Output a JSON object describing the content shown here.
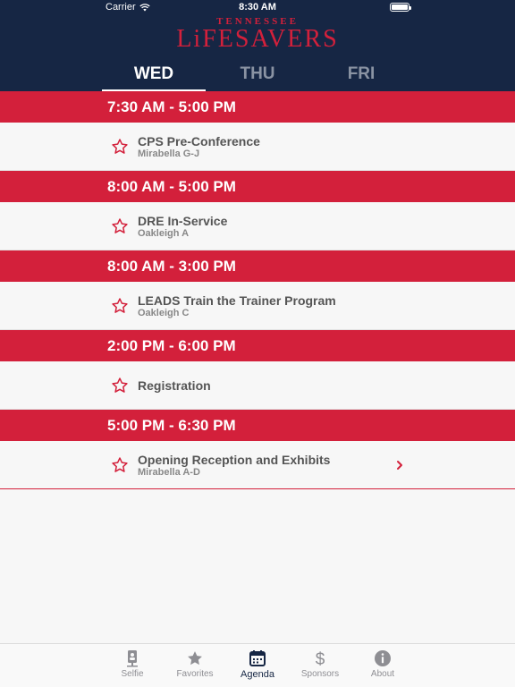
{
  "status_bar": {
    "carrier": "Carrier",
    "time": "8:30 AM"
  },
  "logo": {
    "top": "TENNESSEE",
    "main": "LiFESAVERS"
  },
  "day_tabs": [
    {
      "label": "WED",
      "active": true
    },
    {
      "label": "THU",
      "active": false
    },
    {
      "label": "FRI",
      "active": false
    }
  ],
  "agenda": [
    {
      "time": "7:30 AM - 5:00 PM",
      "title": "CPS Pre-Conference",
      "location": "Mirabella G-J"
    },
    {
      "time": "8:00 AM - 5:00 PM",
      "title": "DRE In-Service",
      "location": "Oakleigh A"
    },
    {
      "time": "8:00 AM - 3:00 PM",
      "title": "LEADS Train the Trainer Program",
      "location": "Oakleigh C"
    },
    {
      "time": "2:00 PM - 6:00 PM",
      "title": "Registration",
      "location": ""
    },
    {
      "time": "5:00 PM - 6:30 PM",
      "title": "Opening Reception and Exhibits",
      "location": "Mirabella A-D",
      "has_detail": true
    }
  ],
  "tab_bar": [
    {
      "label": "Selfie",
      "icon": "selfie-icon"
    },
    {
      "label": "Favorites",
      "icon": "star-icon"
    },
    {
      "label": "Agenda",
      "icon": "calendar-icon",
      "active": true
    },
    {
      "label": "Sponsors",
      "icon": "dollar-icon"
    },
    {
      "label": "About",
      "icon": "info-icon"
    }
  ],
  "colors": {
    "navy": "#162644",
    "red": "#d3203b"
  }
}
